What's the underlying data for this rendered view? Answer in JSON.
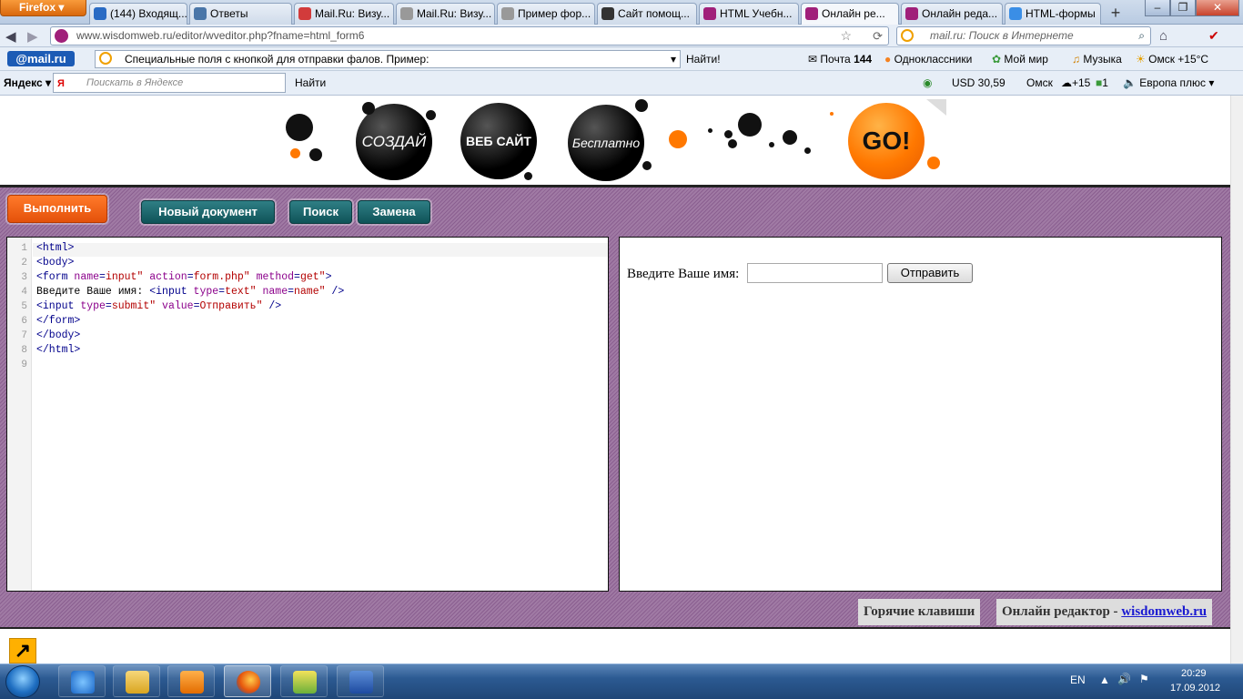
{
  "browser": {
    "app_button": "Firefox",
    "tabs": [
      {
        "label": "(144) Входящ...",
        "icon_color": "#2a6bc4"
      },
      {
        "label": "Ответы",
        "icon_color": "#4a76a8"
      },
      {
        "label": "Mail.Ru: Визу...",
        "icon_color": "#d23b3b"
      },
      {
        "label": "Mail.Ru: Визу...",
        "icon_color": "#999999"
      },
      {
        "label": "Пример фор...",
        "icon_color": "#999999"
      },
      {
        "label": "Сайт помощ...",
        "icon_color": "#333333"
      },
      {
        "label": "HTML Учебн...",
        "icon_color": "#a0207a"
      },
      {
        "label": "Онлайн ре...",
        "icon_color": "#a0207a",
        "active": true
      },
      {
        "label": "Онлайн реда...",
        "icon_color": "#a0207a"
      },
      {
        "label": "HTML-формы",
        "icon_color": "#3a8ee6"
      }
    ],
    "new_tab": "+",
    "url": "www.wisdomweb.ru/editor/wveditor.php?fname=html_form6",
    "search_placeholder": "mail.ru: Поиск в Интернете"
  },
  "mailbar": {
    "logo": "@mail.ru",
    "suggest": "Специальные поля с кнопкой для отправки фалов. Пример:",
    "find": "Найти!",
    "mail": "Почта",
    "mail_count": "144",
    "ok": "Одноклассники",
    "myworld": "Мой мир",
    "music": "Музыка",
    "weather": "Омск +15°C"
  },
  "yandexbar": {
    "logo": "Яндекс",
    "search_placeholder": "Поискать в Яндексе",
    "find": "Найти",
    "usd": "USD 30,59",
    "city": "Омск",
    "temp": "+15",
    "count": "1",
    "radio": "Европа плюс"
  },
  "banner": {
    "ball1": "СОЗДАЙ",
    "ball2": "ВЕБ САЙТ",
    "ball3": "Бесплатно",
    "go": "GO!"
  },
  "editor": {
    "run": "Выполнить",
    "new_doc": "Новый документ",
    "search": "Поиск",
    "replace": "Замена",
    "line_numbers": [
      "1",
      "2",
      "3",
      "4",
      "5",
      "6",
      "7",
      "8",
      "9"
    ],
    "code": [
      "<html>",
      "<body>",
      "<form name=\"input\" action=\"form.php\" method=\"get\">",
      "Введите Ваше имя: <input type=\"text\" name=\"name\" />",
      "<input type=\"submit\" value=\"Отправить\" />",
      "</form>",
      "</body>",
      "</html>",
      ""
    ],
    "preview_label": "Введите Ваше имя:",
    "preview_submit": "Отправить",
    "hotkeys": "Горячие клавиши",
    "footer_prefix": "Онлайн редактор - ",
    "footer_link": "wisdomweb.ru"
  },
  "taskbar": {
    "lang": "EN",
    "time": "20:29",
    "date": "17.09.2012"
  }
}
